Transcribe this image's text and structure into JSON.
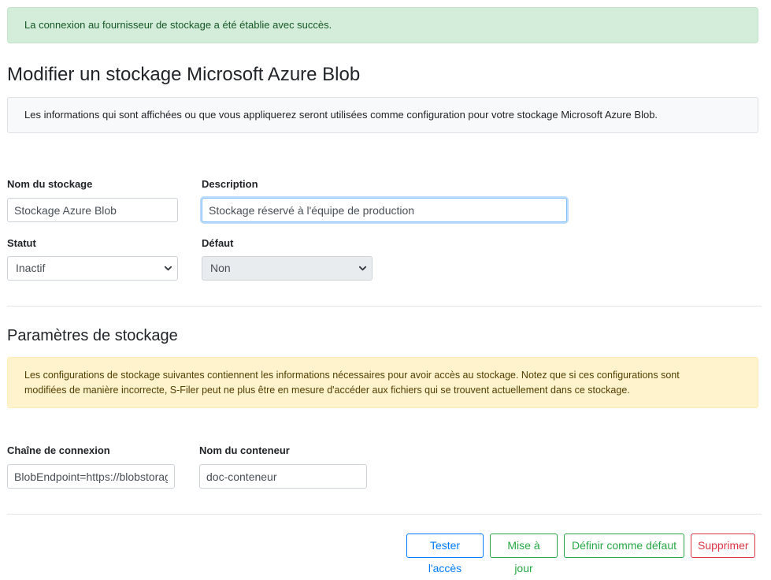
{
  "alerts": {
    "success": "La connexion au fournisseur de stockage a été établie avec succès."
  },
  "page": {
    "title": "Modifier un stockage Microsoft Azure Blob",
    "info": "Les informations qui sont affichées ou que vous appliquerez seront utilisées comme configuration pour votre stockage Microsoft Azure Blob."
  },
  "form": {
    "name": {
      "label": "Nom du stockage",
      "value": "Stockage Azure Blob"
    },
    "description": {
      "label": "Description",
      "value": "Stockage réservé à l'équipe de production"
    },
    "status": {
      "label": "Statut",
      "value": "Inactif"
    },
    "default": {
      "label": "Défaut",
      "value": "Non"
    }
  },
  "storage_params": {
    "title": "Paramètres de stockage",
    "warning_line1": "Les configurations de stockage suivantes contiennent les informations nécessaires pour avoir accès au stockage. Notez que si ces configurations sont",
    "warning_line2": "modifiées de manière incorrecte, S-Filer peut ne plus être en mesure d'accéder aux fichiers qui se trouvent actuellement dans ce stockage.",
    "connection_string": {
      "label": "Chaîne de connexion",
      "value": "BlobEndpoint=https://blobstorage.example.net"
    },
    "container_name": {
      "label": "Nom du conteneur",
      "value": "doc-conteneur"
    }
  },
  "actions": {
    "test": "Tester l'accès",
    "update": "Mise à jour",
    "set_default": "Définir comme défaut",
    "delete": "Supprimer"
  },
  "colors": {
    "primary": "#007bff",
    "success": "#28a745",
    "danger": "#dc3545"
  }
}
